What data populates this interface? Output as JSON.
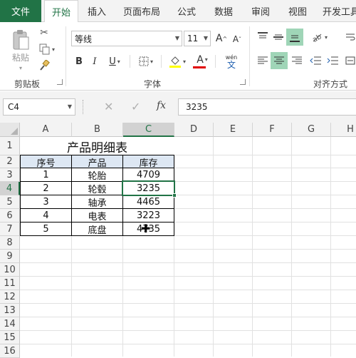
{
  "tabs": {
    "file": "文件",
    "items": [
      "开始",
      "插入",
      "页面布局",
      "公式",
      "数据",
      "审阅",
      "视图",
      "开发工具"
    ]
  },
  "ribbon": {
    "clipboard": {
      "paste": "粘贴",
      "group": "剪贴板"
    },
    "font": {
      "name": "等线",
      "size": "11",
      "bold": "B",
      "italic": "I",
      "underline": "U",
      "grow": "A",
      "shrink": "A",
      "color": "A",
      "phonetic_top": "wén",
      "phonetic_bottom": "文",
      "group": "字体"
    },
    "alignment": {
      "group": "对齐方式"
    }
  },
  "formula_bar": {
    "name_box": "C4",
    "fx": "fx",
    "value": "3235"
  },
  "sheet": {
    "columns": [
      "A",
      "B",
      "C",
      "D",
      "E",
      "F",
      "G",
      "H"
    ],
    "rows": [
      "1",
      "2",
      "3",
      "4",
      "5",
      "6",
      "7",
      "8",
      "9",
      "10",
      "11",
      "12",
      "13",
      "14",
      "15",
      "16"
    ],
    "title": "产品明细表",
    "headers": [
      "序号",
      "产品",
      "库存"
    ],
    "data": [
      [
        "1",
        "轮胎",
        "4709"
      ],
      [
        "2",
        "轮毂",
        "3235"
      ],
      [
        "3",
        "轴承",
        "4465"
      ],
      [
        "4",
        "电表",
        "3223"
      ],
      [
        "5",
        "底盘",
        "4735"
      ]
    ],
    "selected_cell": "C4"
  },
  "colors": {
    "accent": "#217346",
    "header_fill": "#dde7f3"
  }
}
